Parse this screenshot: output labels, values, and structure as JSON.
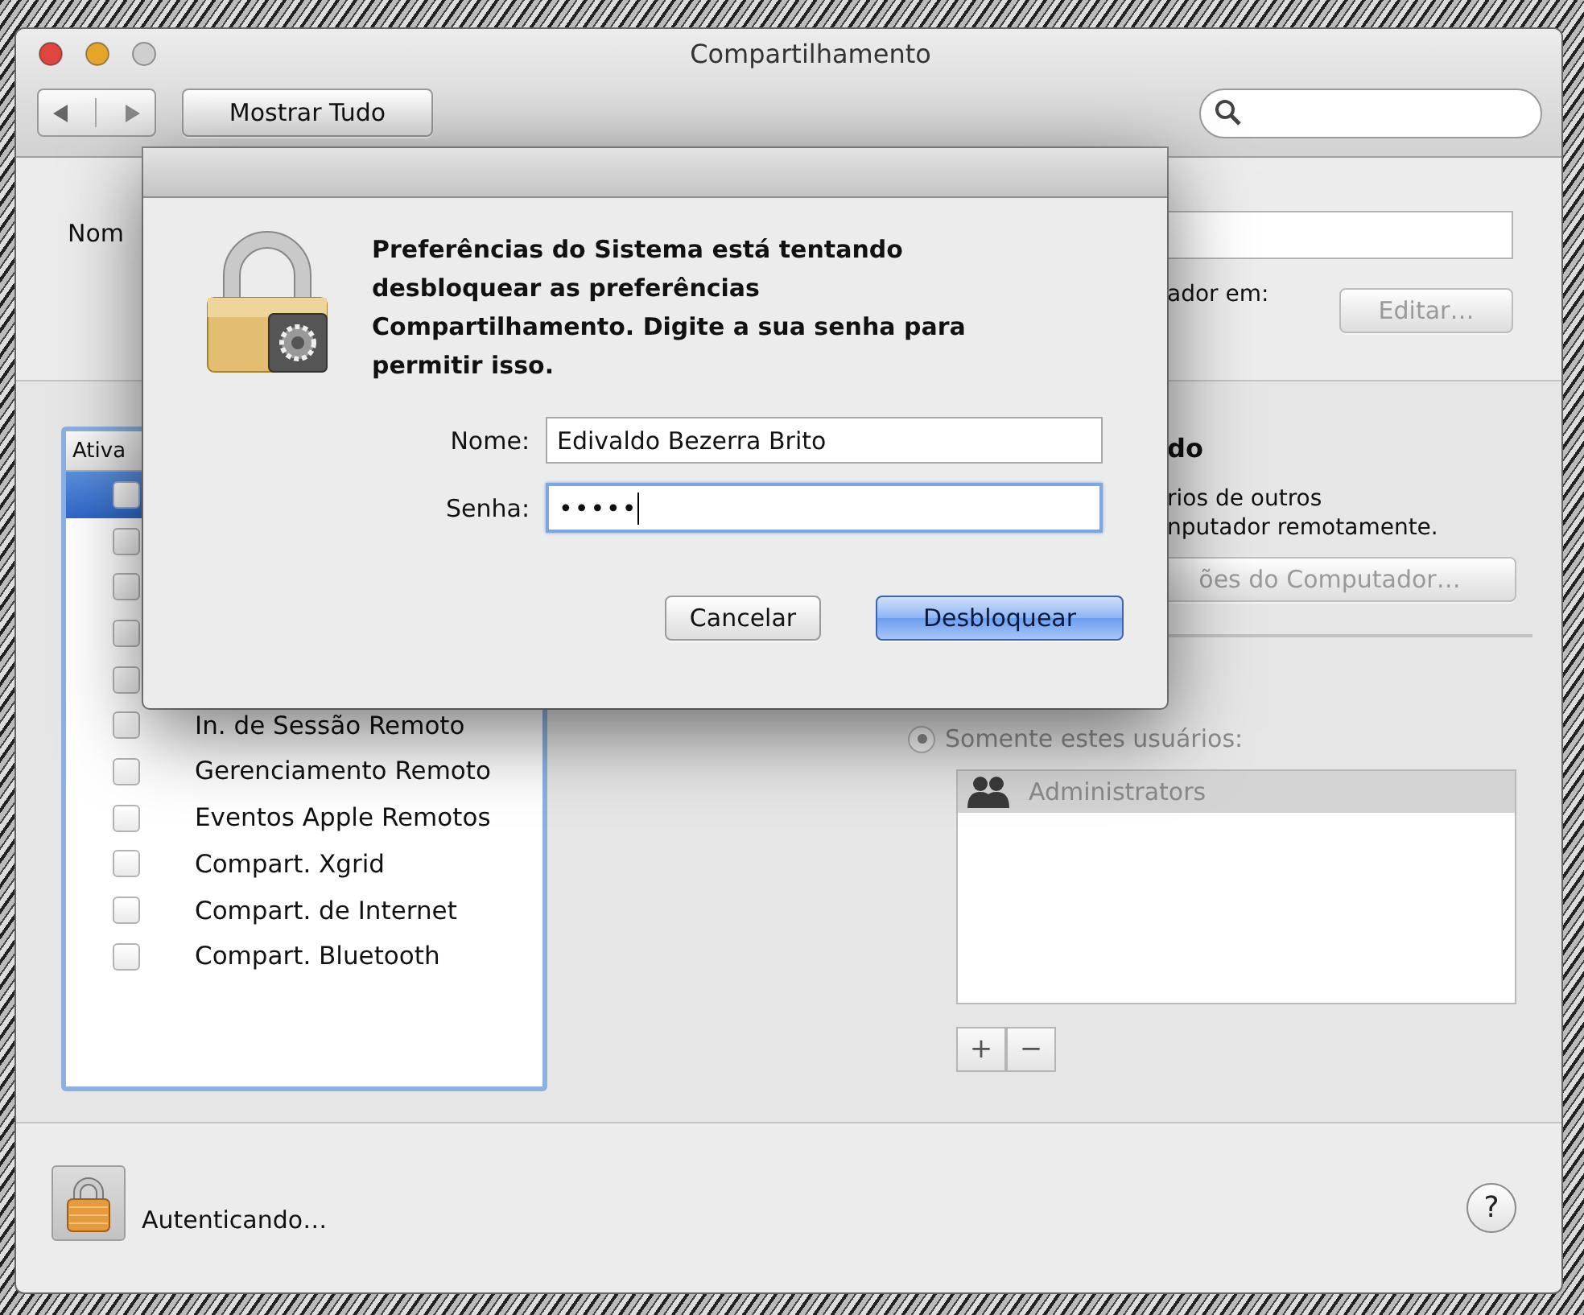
{
  "window": {
    "title": "Compartilhamento"
  },
  "toolbar": {
    "show_all_button": "Mostrar Tudo"
  },
  "computer_name": {
    "label": "Nom",
    "address_fragment": "ador em:",
    "edit_button": {
      "label": "Editar…",
      "disabled": true
    }
  },
  "services": {
    "header": "Ativa",
    "items": [
      {
        "checked": false,
        "selected": true
      },
      {
        "checked": false,
        "selected": false
      },
      {
        "checked": false,
        "selected": false
      },
      {
        "checked": false,
        "selected": false
      },
      {
        "checked": false,
        "selected": false
      },
      {
        "label": "In. de Sessão Remoto",
        "checked": false,
        "selected": false
      },
      {
        "label": "Gerenciamento Remoto",
        "checked": false,
        "selected": false
      },
      {
        "label": "Eventos Apple Remotos",
        "checked": false,
        "selected": false
      },
      {
        "label": "Compart. Xgrid",
        "checked": false,
        "selected": false
      },
      {
        "label": "Compart. de Internet",
        "checked": false,
        "selected": false
      },
      {
        "label": "Compart. Bluetooth",
        "checked": false,
        "selected": false
      }
    ]
  },
  "service_detail": {
    "title_fragment": "do",
    "description_lines": [
      "rios de outros",
      "nputador remotamente."
    ],
    "settings_button": {
      "label": "ões do Computador…",
      "disabled": true
    },
    "access_radios": [
      {
        "label": "Somente estes usuários:",
        "selected": true
      }
    ],
    "users": [
      {
        "name": "Administrators"
      }
    ],
    "add_button": "+",
    "remove_button": "−"
  },
  "footer": {
    "status": "Autenticando…",
    "help_button": "?"
  },
  "auth_dialog": {
    "message": "Preferências do Sistema está tentando desbloquear as preferências Compartilhamento. Digite a sua senha para permitir isso.",
    "fields": [
      {
        "label": "Nome:",
        "value": "Edivaldo Bezerra Brito",
        "kind": "text",
        "focused": false
      },
      {
        "label": "Senha:",
        "value": "•••••",
        "kind": "password",
        "focused": true
      }
    ],
    "buttons": [
      {
        "label": "Cancelar",
        "default": false
      },
      {
        "label": "Desbloquear",
        "default": true
      }
    ]
  }
}
